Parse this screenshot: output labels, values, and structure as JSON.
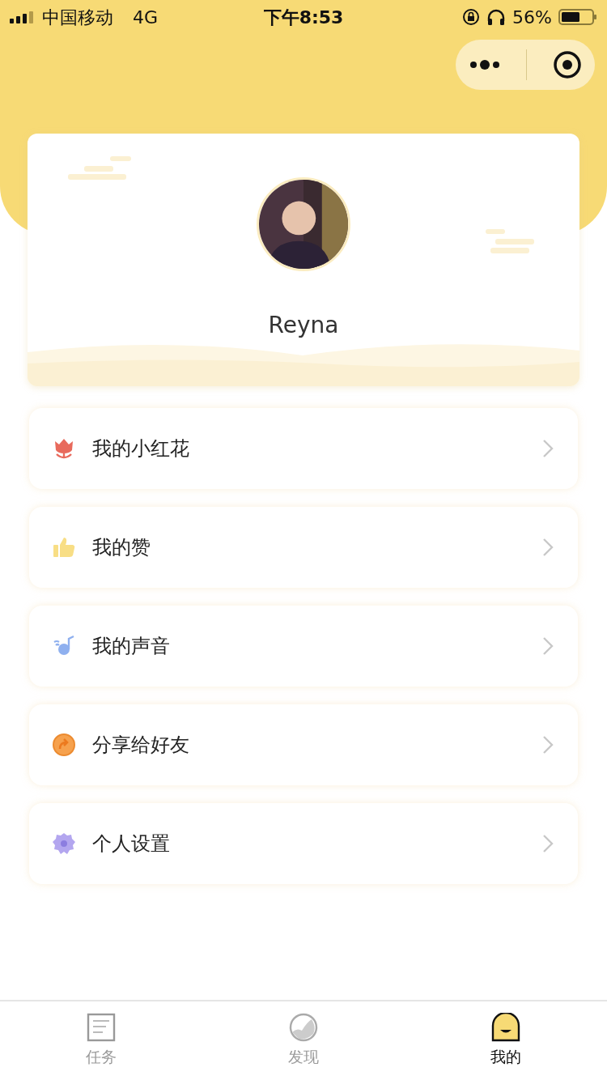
{
  "status_bar": {
    "carrier": "中国移动",
    "network": "4G",
    "time": "下午8:53",
    "battery": "56%"
  },
  "profile": {
    "name": "Reyna"
  },
  "menu": [
    {
      "kind": "flower",
      "label": "我的小红花"
    },
    {
      "kind": "thumb",
      "label": "我的赞"
    },
    {
      "kind": "voice",
      "label": "我的声音"
    },
    {
      "kind": "share",
      "label": "分享给好友"
    },
    {
      "kind": "gear",
      "label": "个人设置"
    }
  ],
  "tabs": [
    {
      "kind": "task",
      "label": "任务",
      "selected": false
    },
    {
      "kind": "discover",
      "label": "发现",
      "selected": false
    },
    {
      "kind": "me",
      "label": "我的",
      "selected": true
    }
  ]
}
